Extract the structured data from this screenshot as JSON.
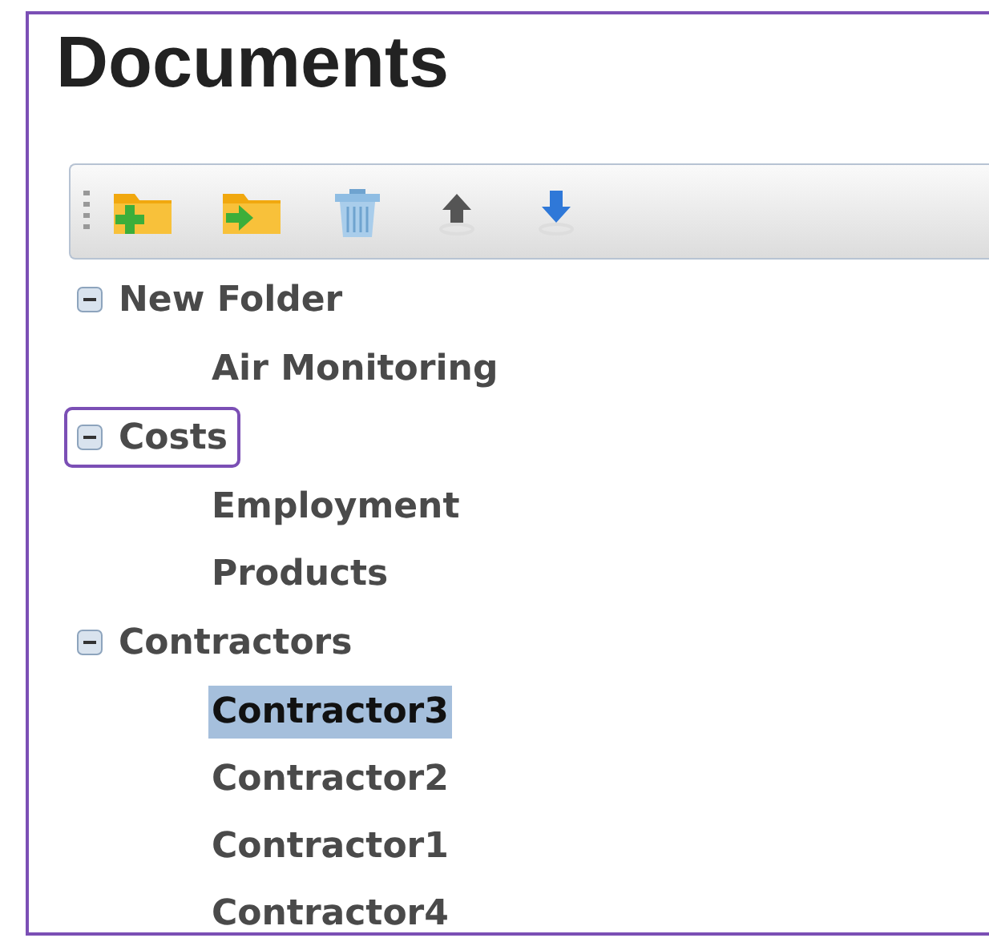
{
  "title": "Documents",
  "toolbar": [
    {
      "kind": "new-folder"
    },
    {
      "kind": "move-folder"
    },
    {
      "kind": "delete"
    },
    {
      "kind": "up"
    },
    {
      "kind": "down"
    }
  ],
  "tree": [
    {
      "label": "New Folder",
      "expanded": true,
      "focused": false,
      "selected": false,
      "children": [
        {
          "label": "Air Monitoring",
          "selected": false
        }
      ]
    },
    {
      "label": "Costs",
      "expanded": true,
      "focused": true,
      "selected": false,
      "children": [
        {
          "label": "Employment",
          "selected": false
        },
        {
          "label": "Products",
          "selected": false
        }
      ]
    },
    {
      "label": "Contractors",
      "expanded": true,
      "focused": false,
      "selected": false,
      "children": [
        {
          "label": "Contractor3",
          "selected": true
        },
        {
          "label": "Contractor2",
          "selected": false
        },
        {
          "label": "Contractor1",
          "selected": false
        },
        {
          "label": "Contractor4",
          "selected": false
        }
      ]
    }
  ]
}
